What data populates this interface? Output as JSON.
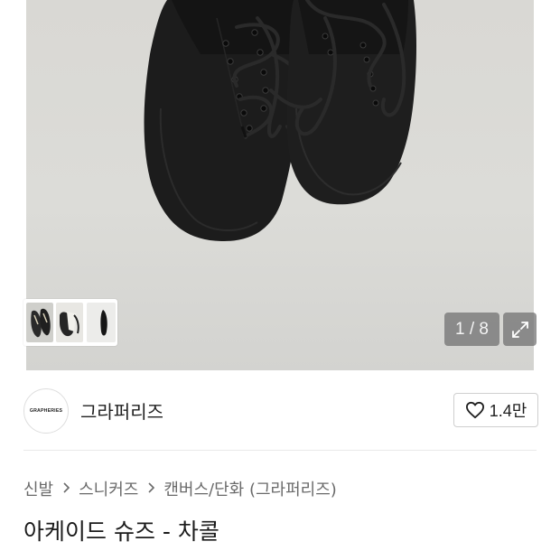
{
  "gallery": {
    "counter": "1 / 8",
    "expand_icon": "expand-icon",
    "thumbnail_next_icon": "chevron-right-icon"
  },
  "brand": {
    "logo_text": "GRAPHERIES",
    "name": "그라퍼리즈",
    "like_icon": "heart-outline-icon",
    "like_count": "1.4만"
  },
  "breadcrumb": {
    "items": [
      "신발",
      "스니커즈",
      "캔버스/단화 (그라퍼리즈)"
    ],
    "separator_icon": "chevron-right-icon"
  },
  "product": {
    "title": "아케이드 슈즈 - 차콜"
  },
  "colors": {
    "text_primary": "#1f1f1f",
    "text_secondary": "#6a6a6a",
    "overlay": "#6e6e6e",
    "divider": "#e9e9e9"
  }
}
